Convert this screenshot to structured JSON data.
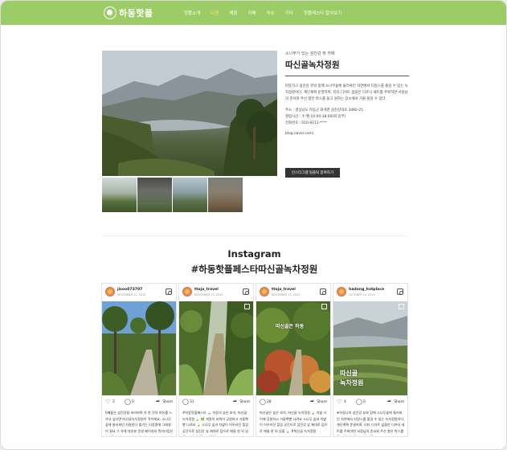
{
  "nav": {
    "logo": "하동핫플",
    "menu": [
      "핫플소개",
      "다원",
      "체험",
      "카페",
      "숙소",
      "기타",
      "핫플레스타 알아보기"
    ],
    "active_index": 1,
    "bar_color": "#9ccc65",
    "active_color": "#f5e663"
  },
  "place": {
    "subtitle": "소나무가 있는 섬진강 뷰 카페",
    "title": "따신골녹차정원",
    "description": "따뜻하고 섬진강 뷰와 함께 소나무숲에 둘러싸인 자연에서 티캉스를 즐길 수 있는 녹차정원이다. 계단계획 운영하며, 티타 디저트 없을은 더프닉 세트를 주위하면 서정님의 준서와 주선 향은 박스를 들고 원하는 장소에서 가볼 될길 수 있다.",
    "address": "주소 : 경상남도 하동군 화개면 섬진강대로 3480-25",
    "hours": "영업시간 : 수-월 10:00-18:00(화 휴무)",
    "phone": "전화번호 : 010-9211-****",
    "blog": "blog.naver.com/",
    "button_label": "인스타그램 릴플틱 참여하기"
  },
  "instagram": {
    "heading": "Instagram",
    "hashtag": "#하동핫플페스타따신골녹차정원",
    "share_label": "Share",
    "posts": [
      {
        "user": "jisoo073707",
        "date": "NOVEMBER 21, 2025",
        "likes": "2",
        "comments": "0",
        "text": "0째돌은 섬진강을 바라보며 차 한 잔의 여유를 느끼고 싶다면 따신골녹차정원이 딱이에요. 소나무숲에 둘러싸인 자잘한다 즐기는 티정원에 그래말이 필요 그 자체 대부분 운영 베이지와 뭐치티업은 쉬에를 수 있고, 마크는 세"
      },
      {
        "user": "ttoja_travel",
        "date": "NOVEMBER 15, 2025",
        "likes": "31",
        "comments": "",
        "text": "#하동핫플페스타 🍃 하동의 숨은 보석, 따신골 녹차정원 🍃 🌿 계절이 바뀌어 공원하고 가을햇볕 나려요 🍃 소나무 숲과 차밭이 어우러진 힐링 공간으로 섬진강 뷰 제대로 덤으로 애들 한 뒤 있을 🍃 #따신골 녹차정원"
      },
      {
        "user": "ttoja_travel",
        "date": "NOVEMBER 15, 2025",
        "likes": "28",
        "comments": "",
        "text": "따신골은 숨은 보석, 따신골 녹차정원 🍃 차밭 사이에 공원하고 가을햇볕 나려요 소나무 숲과 차밭이 어우러진 힐링 공간으로 섬진강 뷰 제대로 덤으로 애들 한 뒤 있을 🍃 #따신골 녹차정원"
      },
      {
        "user": "hadong_hotplace",
        "date": "OCTOBER 24, 2025",
        "likes": "4",
        "comments": "0",
        "text": "❄하동나의 섬진강 뷰와 함께 소나무숲에 둘러싸인 자연에서 티캉스를 즐길 수 있는 녹차정원이다. 계단계획 운영하며, 티타 디저트 없을만 더프닉 세트를 주위하면 서정님의 준서와 주선 향은 박스를 들고 원하는 장소에서 가볼"
      }
    ],
    "overlay_post2": "따신골은 하동",
    "overlay_post4_line1": "따신골",
    "overlay_post4_line2": "녹차정원"
  }
}
